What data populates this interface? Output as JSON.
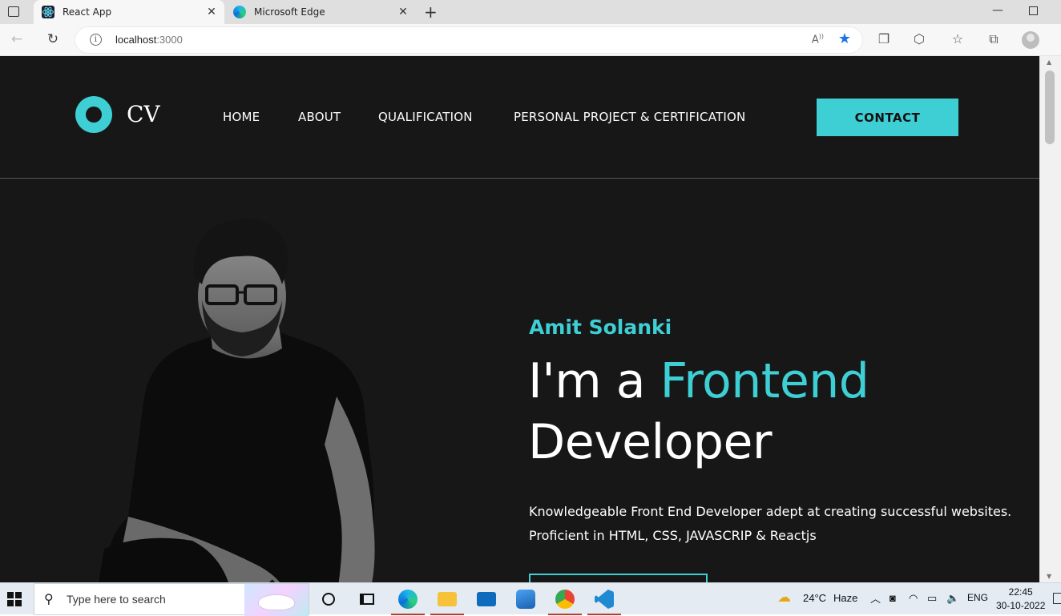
{
  "browser": {
    "tabs": [
      {
        "title": "React App"
      },
      {
        "title": "Microsoft Edge"
      }
    ],
    "new_tab_glyph": "+",
    "url_host": "localhost",
    "url_port": ":3000"
  },
  "site": {
    "logo_text": "CV",
    "nav": [
      "HOME",
      "ABOUT",
      "QUALIFICATION",
      "PERSONAL PROJECT & CERTIFICATION"
    ],
    "contact_label": "CONTACT",
    "name": "Amit Solanki",
    "headline_prefix": "I'm a ",
    "headline_highlight": "Frontend",
    "headline_suffix": "Developer",
    "description_line1": "Knowledgeable Front End Developer adept at creating successful websites.",
    "description_line2": "Proficient in HTML, CSS, JAVASCRIP & Reactjs",
    "accent_color": "#3ecfd4",
    "background_color": "#171717"
  },
  "taskbar": {
    "search_placeholder": "Type here to search",
    "weather": "24°C",
    "weather_desc": "Haze",
    "language": "ENG",
    "time": "22:45",
    "date": "30-10-2022"
  }
}
